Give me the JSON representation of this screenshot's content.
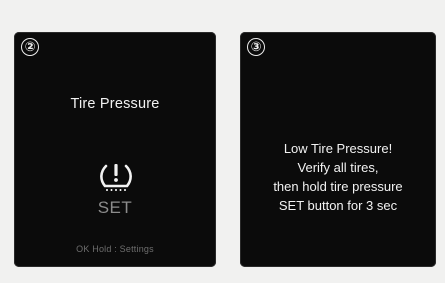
{
  "colors": {
    "background": "#f1f1f0",
    "panel": "#0b0b0b",
    "text": "#f2f2f2",
    "dim_text": "#8c8c8c",
    "hint_text": "#6e6e6e"
  },
  "panel_2": {
    "step": "②",
    "title": "Tire Pressure",
    "icon": "tpms-warning-icon",
    "set_label": "SET",
    "hint": "OK Hold : Settings"
  },
  "panel_3": {
    "step": "③",
    "lines": [
      "Low Tire Pressure!",
      "Verify all tires,",
      "then hold tire pressure",
      "SET button for 3 sec"
    ]
  }
}
